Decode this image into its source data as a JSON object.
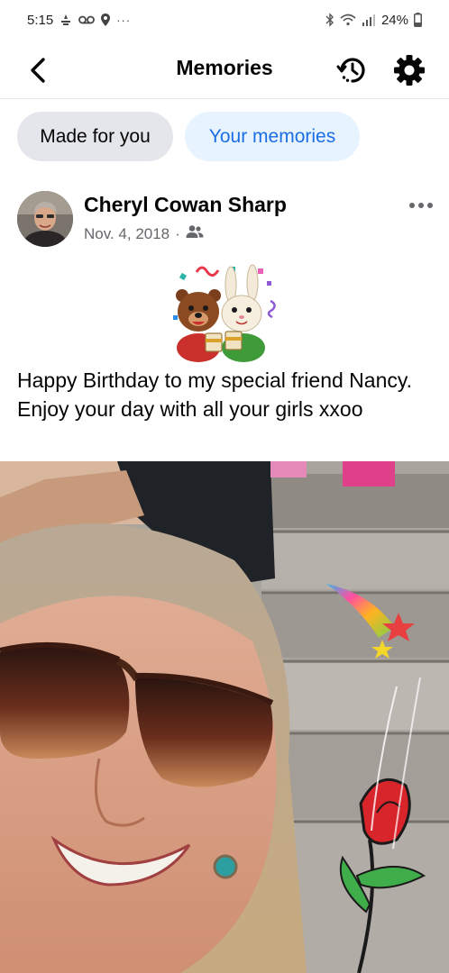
{
  "status_bar": {
    "time": "5:15",
    "battery": "24%"
  },
  "header": {
    "title": "Memories"
  },
  "chips": [
    {
      "label": "Made for you"
    },
    {
      "label": "Your memories"
    }
  ],
  "post": {
    "author": "Cheryl Cowan Sharp",
    "date": "Nov. 4, 2018",
    "meta_separator": "·",
    "audience_icon": "friends-icon",
    "text": "Happy Birthday to my special friend Nancy. Enjoy your day with all your girls xxoo"
  },
  "colors": {
    "accent": "#1b6ee4",
    "chip_selected_bg": "#e7f3ff",
    "chip_bg": "#e4e6eb",
    "secondary_text": "#65676b"
  }
}
